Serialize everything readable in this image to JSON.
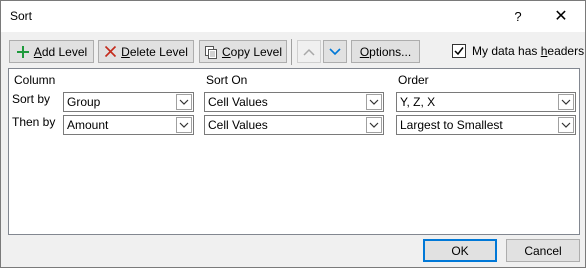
{
  "window": {
    "title": "Sort",
    "help": "?",
    "close": "✕"
  },
  "toolbar": {
    "add_level_mnemonic": "A",
    "add_level_rest": "dd Level",
    "delete_level_mnemonic": "D",
    "delete_level_rest": "elete Level",
    "copy_level_mnemonic": "C",
    "copy_level_rest": "opy Level",
    "options_mnemonic": "O",
    "options_rest": "ptions...",
    "headers_pre": "My data has ",
    "headers_mnemonic": "h",
    "headers_rest": "eaders",
    "headers_checked": true
  },
  "columns": {
    "column": "Column",
    "sort_on": "Sort On",
    "order": "Order"
  },
  "rows": [
    {
      "label": "Sort by",
      "column": "Group",
      "sort_on": "Cell Values",
      "order": "Y, Z, X"
    },
    {
      "label": "Then by",
      "column": "Amount",
      "sort_on": "Cell Values",
      "order": "Largest to Smallest"
    }
  ],
  "footer": {
    "ok": "OK",
    "cancel": "Cancel"
  },
  "colors": {
    "accent": "#0078d7",
    "add_icon": "#1e9a3c",
    "delete_icon": "#c42b1c"
  }
}
